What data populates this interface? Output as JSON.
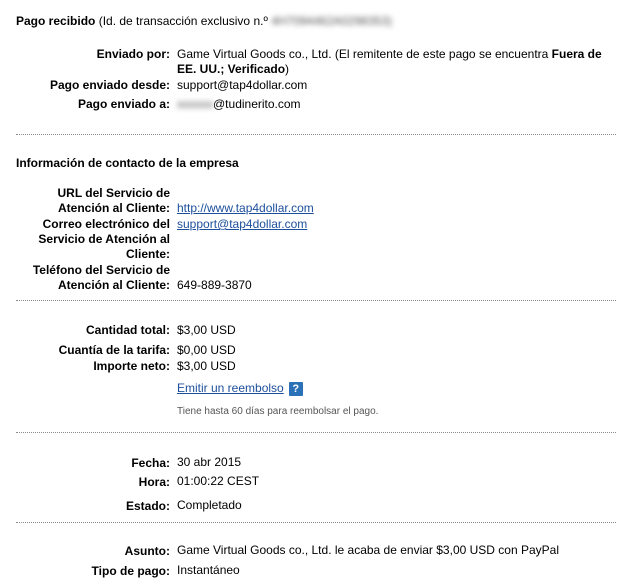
{
  "header": {
    "title": "Pago recibido",
    "transaction_prefix": "(Id. de transacción exclusivo n.º",
    "transaction_id": "4H7094462A0298353)"
  },
  "sender": {
    "sent_by_label": "Enviado por:",
    "sent_by_value_1": "Game Virtual Goods co., Ltd. (El remitente de este pago se encuentra",
    "sent_by_bold_1": "Fuera de",
    "sent_by_bold_2": "EE. UU.; Verificado",
    "sent_by_close": ")",
    "sent_from_label": "Pago enviado desde:",
    "sent_from_value": "support@tap4dollar.com",
    "sent_to_label": "Pago enviado a:",
    "sent_to_hidden": "xxxxxx",
    "sent_to_domain": "@tudinerito.com"
  },
  "company": {
    "section_title": "Información de contacto de la empresa",
    "url_label_1": "URL del Servicio de",
    "url_label_2": "Atención al Cliente:",
    "url_value": "http://www.tap4dollar.com",
    "email_label_1": "Correo electrónico del",
    "email_label_2": "Servicio de Atención al",
    "email_label_3": "Cliente:",
    "email_value": "support@tap4dollar.com",
    "phone_label_1": "Teléfono del Servicio de",
    "phone_label_2": "Atención al Cliente:",
    "phone_value": "649-889-3870"
  },
  "amounts": {
    "total_label": "Cantidad total:",
    "total_value": "$3,00 USD",
    "fee_label": "Cuantía de la tarifa:",
    "fee_value": "$0,00 USD",
    "net_label": "Importe neto:",
    "net_value": "$3,00 USD",
    "refund_link": "Emitir un reembolso",
    "help_icon": "?",
    "refund_note": "Tiene hasta 60 días para reembolsar el pago."
  },
  "details": {
    "date_label": "Fecha:",
    "date_value": "30 abr 2015",
    "time_label": "Hora:",
    "time_value": "01:00:22 CEST",
    "status_label": "Estado:",
    "status_value": "Completado"
  },
  "footer": {
    "subject_label": "Asunto:",
    "subject_value": "Game Virtual Goods co., Ltd. le acaba de enviar $3,00 USD con PayPal",
    "payment_type_label": "Tipo de pago:",
    "payment_type_value": "Instantáneo"
  }
}
